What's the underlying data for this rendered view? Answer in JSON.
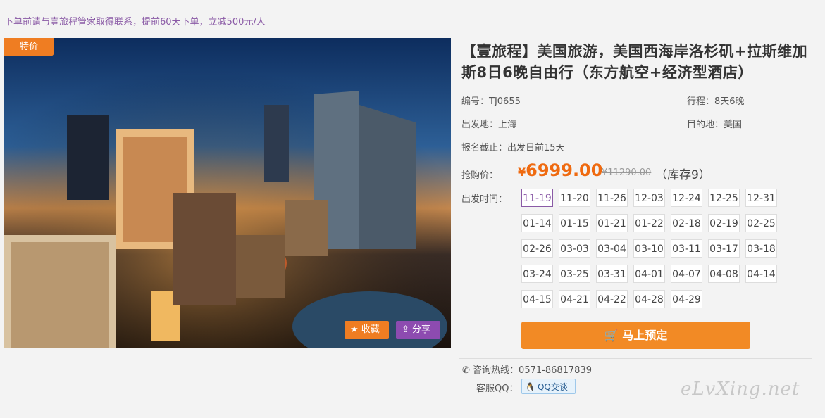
{
  "notice": "下单前请与壹旅程管家取得联系，提前60天下单，立减500元/人",
  "hero": {
    "badge": "特价",
    "favorite_label": "收藏",
    "share_label": "分享"
  },
  "product": {
    "title": "【壹旅程】美国旅游，美国西海岸洛杉矶+拉斯维加斯8日6晚自由行（东方航空+经济型酒店）",
    "code": "编号：TJ0655",
    "itinerary": "行程：8天6晚",
    "departure": "出发地：上海",
    "destination": "目的地：美国",
    "deadline": "报名截止：出发日前15天",
    "price_label": "抢购价：",
    "price_symbol": "¥",
    "price": "6999.00",
    "old_price": "¥11290.00",
    "stock": "（库存9）",
    "dates_label": "出发时间：",
    "dates": [
      "11-19",
      "11-20",
      "11-26",
      "12-03",
      "12-24",
      "12-25",
      "12-31",
      "01-14",
      "01-15",
      "01-21",
      "01-22",
      "02-18",
      "02-19",
      "02-25",
      "02-26",
      "03-03",
      "03-04",
      "03-10",
      "03-11",
      "03-17",
      "03-18",
      "03-24",
      "03-25",
      "03-31",
      "04-01",
      "04-07",
      "04-08",
      "04-14",
      "04-15",
      "04-21",
      "04-22",
      "04-28",
      "04-29"
    ],
    "selected_date": "11-19",
    "book_label": "马上预定"
  },
  "contact": {
    "hotline": "咨询热线：0571-86817839",
    "qq_label": "客服QQ：",
    "qq_button": "QQ交谈"
  },
  "watermark": "eLvXing.net",
  "colors": {
    "accent_orange": "#ef7d22",
    "accent_purple": "#8a5aa6",
    "price": "#ef6a10"
  }
}
